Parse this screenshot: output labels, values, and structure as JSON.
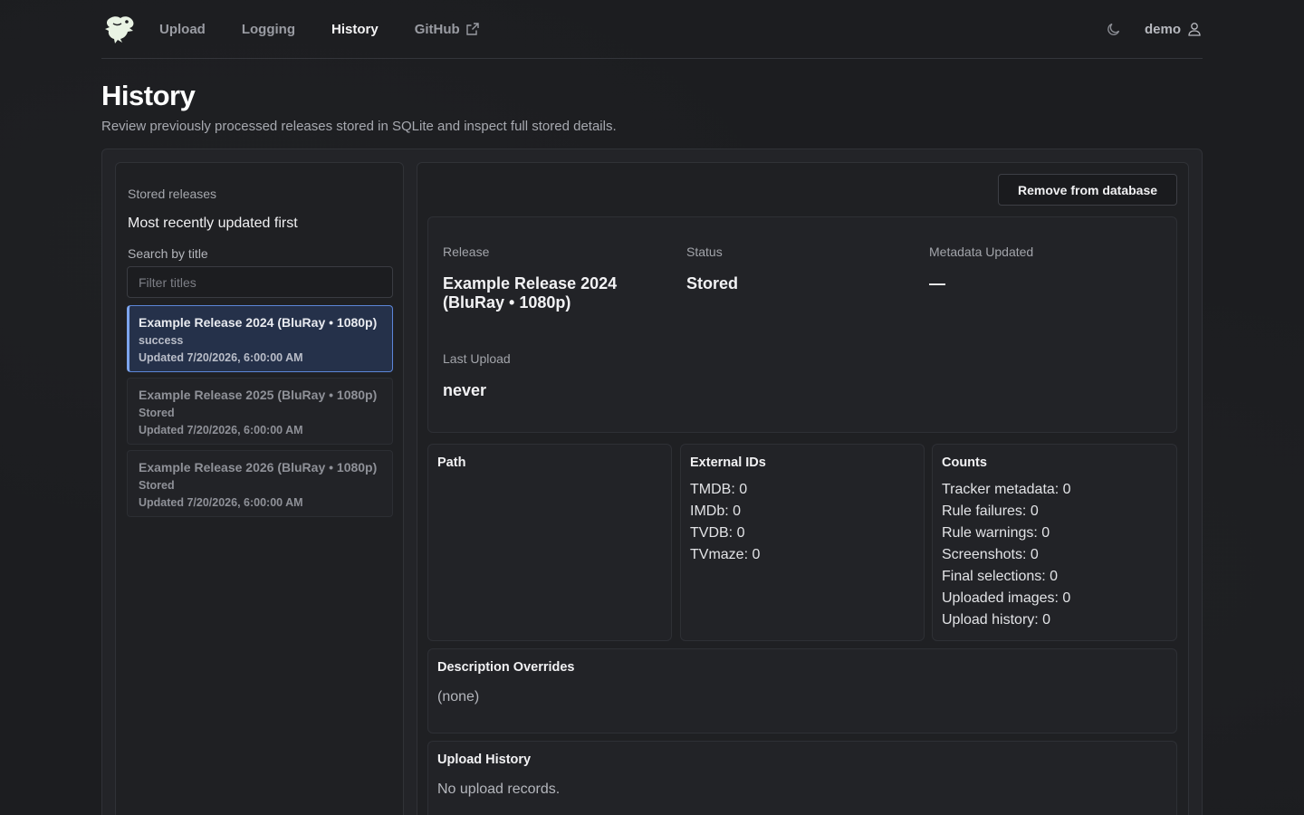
{
  "nav": {
    "items": [
      {
        "label": "Upload",
        "active": false
      },
      {
        "label": "Logging",
        "active": false
      },
      {
        "label": "History",
        "active": true
      },
      {
        "label": "GitHub",
        "active": false,
        "external": true
      }
    ],
    "user": "demo",
    "theme_icon": "moon-icon",
    "user_icon": "user-icon",
    "logo_icon": "dragon-logo-icon"
  },
  "page": {
    "title": "History",
    "subtitle": "Review previously processed releases stored in SQLite and inspect full stored details."
  },
  "sidebar": {
    "caption": "Stored releases",
    "title": "Most recently updated first",
    "search_label": "Search by title",
    "search_placeholder": "Filter titles",
    "search_value": "",
    "releases": [
      {
        "title": "Example Release 2024 (BluRay • 1080p)",
        "status": "success",
        "updated": "Updated 7/20/2026, 6:00:00 AM",
        "selected": true
      },
      {
        "title": "Example Release 2025 (BluRay • 1080p)",
        "status": "Stored",
        "updated": "Updated 7/20/2026, 6:00:00 AM",
        "selected": false
      },
      {
        "title": "Example Release 2026 (BluRay • 1080p)",
        "status": "Stored",
        "updated": "Updated 7/20/2026, 6:00:00 AM",
        "selected": false
      }
    ]
  },
  "detail": {
    "remove_label": "Remove from database",
    "summary": {
      "release_label": "Release",
      "release_value": "Example Release 2024 (BluRay • 1080p)",
      "status_label": "Status",
      "status_value": "Stored",
      "metadata_label": "Metadata Updated",
      "metadata_value": "—",
      "last_upload_label": "Last Upload",
      "last_upload_value": "never"
    },
    "path": {
      "title": "Path"
    },
    "external_ids": {
      "title": "External IDs",
      "lines": [
        "TMDB: 0",
        "IMDb: 0",
        "TVDB: 0",
        "TVmaze: 0"
      ]
    },
    "counts": {
      "title": "Counts",
      "lines": [
        "Tracker metadata: 0",
        "Rule failures: 0",
        "Rule warnings: 0",
        "Screenshots: 0",
        "Final selections: 0",
        "Uploaded images: 0",
        "Upload history: 0"
      ]
    },
    "description_overrides": {
      "title": "Description Overrides",
      "text": "(none)"
    },
    "upload_history": {
      "title": "Upload History",
      "text": "No upload records."
    }
  },
  "colors": {
    "background": "#1c1d20",
    "selected_bg": "#25314a",
    "selected_border": "#7da5ee",
    "logo": "#e9f3e4"
  }
}
